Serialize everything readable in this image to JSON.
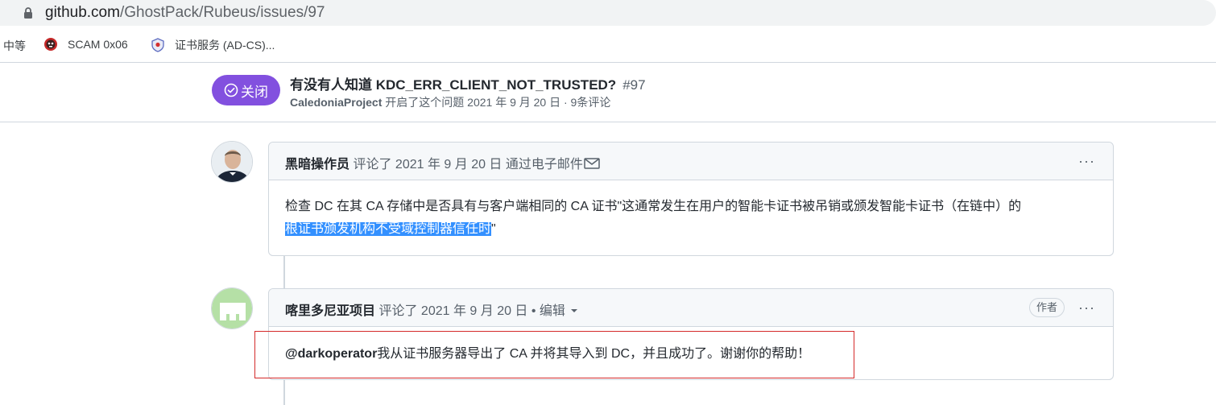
{
  "browser": {
    "url_host": "github.com",
    "url_path": "/GhostPack/Rubeus/issues/97",
    "bookmarks": [
      {
        "label": "中等"
      },
      {
        "label": "SCAM 0x06",
        "icon": "skull-icon"
      },
      {
        "label": "证书服务 (AD-CS)...",
        "icon": "shield-icon"
      }
    ]
  },
  "issue": {
    "state_label": "关闭",
    "state_color": "#8250df",
    "title": "有没有人知道 KDC_ERR_CLIENT_NOT_TRUSTED?",
    "number": "#97",
    "author": "CaledoniaProject",
    "meta": "开启了这个问题 2021 年 9 月 20 日 · 9条评论"
  },
  "comments": [
    {
      "author": "黑暗操作员",
      "action": "评论了 2021 年 9 月 20 日 通过电子邮件",
      "body_plain": "检查 DC 在其 CA 存储中是否具有与客户端相同的 CA 证书\"这通常发生在用户的智能卡证书被吊销或颁发智能卡证书（在链中）的",
      "body_highlight": "根证书颁发机构不受域控制器信任时",
      "body_tail": "\"",
      "menu": "···"
    },
    {
      "author": "喀里多尼亚项目",
      "action": "评论了 2021 年 9 月 20 日 • 编辑",
      "badge": "作者",
      "mention": "@darkoperator",
      "body": "我从证书服务器导出了 CA 并将其导入到 DC，并且成功了。谢谢你的帮助！",
      "menu": "···"
    }
  ]
}
